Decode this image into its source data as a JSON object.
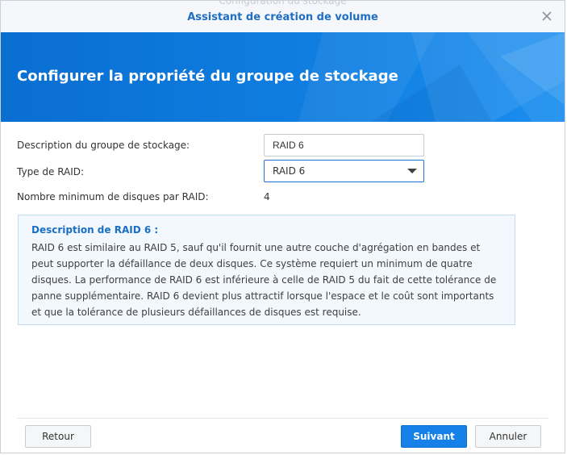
{
  "window": {
    "background_title": "Configuration du stockage",
    "title": "Assistant de création de volume"
  },
  "banner": {
    "heading": "Configurer la propriété du groupe de stockage"
  },
  "form": {
    "description_label": "Description du groupe de stockage:",
    "description_value": "RAID 6",
    "raid_type_label": "Type de RAID:",
    "raid_type_value": "RAID 6",
    "min_disks_label": "Nombre minimum de disques par RAID:",
    "min_disks_value": "4"
  },
  "info": {
    "heading": "Description de RAID 6 :",
    "body": "RAID 6 est similaire au RAID 5, sauf qu'il fournit une autre couche d'agrégation en bandes et peut supporter la défaillance de deux disques. Ce système requiert un minimum de quatre disques. La performance de RAID 6 est inférieure à celle de RAID 5 du fait de cette tolérance de panne supplémentaire. RAID 6 devient plus attractif lorsque l'espace et le coût sont importants et que la tolérance de plusieurs défaillances de disques est requise."
  },
  "footer": {
    "back_label": "Retour",
    "next_label": "Suivant",
    "cancel_label": "Annuler"
  },
  "colors": {
    "accent": "#1580e8",
    "title": "#1e6fc4",
    "banner": "#0a6ed1"
  },
  "icons": {
    "close": "close-icon",
    "dropdown": "chevron-down-icon"
  }
}
